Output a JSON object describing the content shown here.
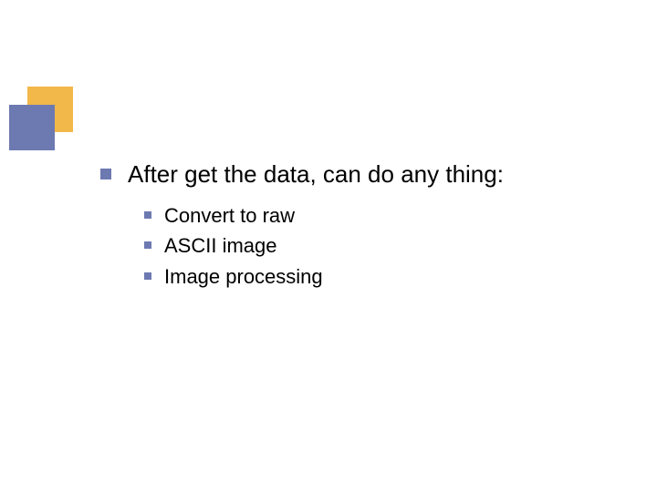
{
  "slide": {
    "heading": "After get the data, can do any thing:",
    "sub_items": [
      "Convert to raw",
      "ASCII image",
      "Image processing"
    ]
  },
  "theme": {
    "accent_blue": "#6d79b1",
    "accent_orange": "#f3b84a"
  }
}
